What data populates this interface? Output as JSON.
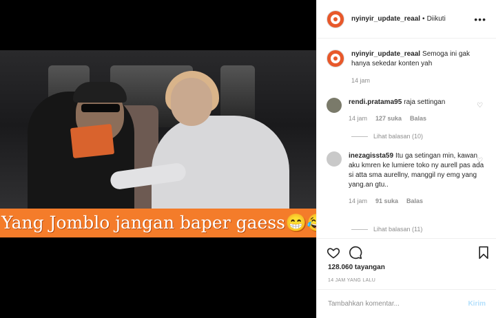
{
  "video": {
    "caption": "Yang Jomblo jangan baper gaess😁😂😂😂"
  },
  "header": {
    "username": "nyinyir_update_reaal",
    "separator": "•",
    "follow_status": "Diikuti",
    "more_icon": "more-dots-icon"
  },
  "caption_comment": {
    "username": "nyinyir_update_reaal",
    "text": "Semoga ini gak hanya sekedar konten yah",
    "time": "14 jam"
  },
  "comments": [
    {
      "username": "rendi.pratama95",
      "text": "raja settingan",
      "time": "14 jam",
      "likes": "127 suka",
      "reply": "Balas",
      "view_replies": "Lihat balasan (10)"
    },
    {
      "username": "inezagissta59",
      "text": "Itu ga setingan min, kawan aku kmren ke lumiere toko ny aurell pas ada si atta sma aurellny, manggil ny emg yang yang.an gtu..",
      "time": "14 jam",
      "likes": "91 suka",
      "reply": "Balas",
      "view_replies": "Lihat balasan (11)"
    }
  ],
  "stats": {
    "views": "128.060 tayangan",
    "posted": "14 JAM YANG LALU"
  },
  "composer": {
    "placeholder": "Tambahkan komentar...",
    "post_label": "Kirim"
  },
  "colors": {
    "caption_bar": "#f47c2a",
    "avatar_brand": "#e8582a",
    "post_disabled": "#b2dffc"
  }
}
